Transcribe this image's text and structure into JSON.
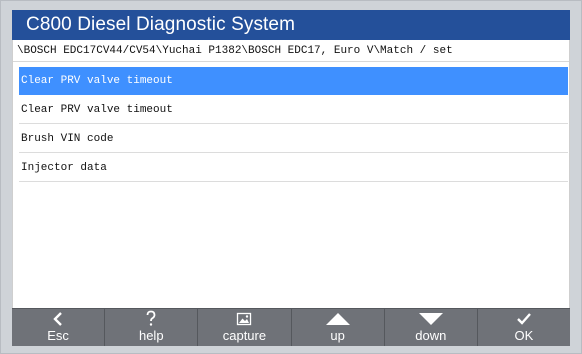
{
  "window": {
    "title": "C800 Diesel Diagnostic System"
  },
  "breadcrumb": "\\BOSCH EDC17CV44/CV54\\Yuchai P1382\\BOSCH EDC17, Euro V\\Match / set",
  "list": {
    "items": [
      {
        "label": "Clear PRV valve timeout",
        "selected": true
      },
      {
        "label": "Clear PRV valve timeout",
        "selected": false
      },
      {
        "label": "Brush VIN code",
        "selected": false
      },
      {
        "label": "Injector data",
        "selected": false
      }
    ]
  },
  "toolbar": {
    "buttons": [
      {
        "label": "Esc",
        "icon": "chevron-left-icon"
      },
      {
        "label": "help",
        "icon": "question-icon"
      },
      {
        "label": "capture",
        "icon": "image-capture-icon"
      },
      {
        "label": "up",
        "icon": "triangle-up-icon"
      },
      {
        "label": "down",
        "icon": "triangle-down-icon"
      },
      {
        "label": "OK",
        "icon": "checkmark-icon"
      }
    ]
  },
  "colors": {
    "titlebar": "#24509a",
    "selected_row": "#3f90ff",
    "toolbar": "#6f7278"
  }
}
